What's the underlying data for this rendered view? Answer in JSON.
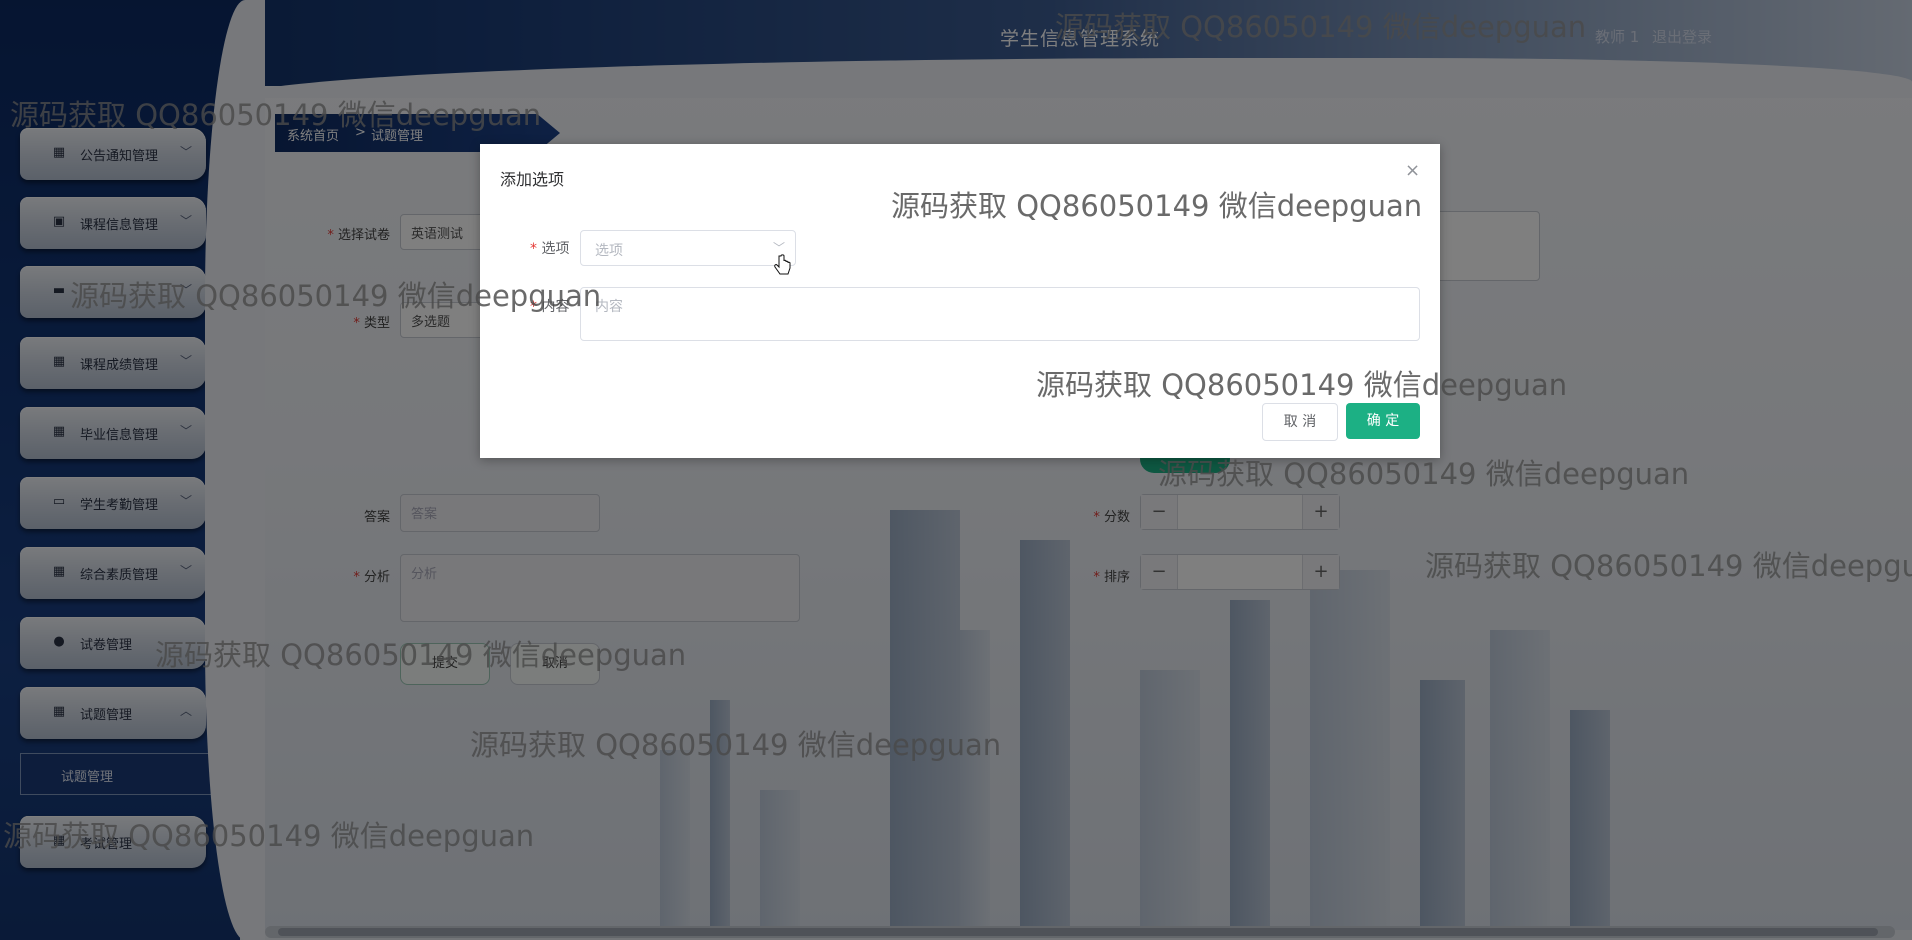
{
  "header": {
    "title": "学生信息管理系统",
    "user": "教师 1",
    "logout": "退出登录"
  },
  "sidebar": {
    "items": [
      {
        "label": "公告通知管理",
        "icon": "grid-icon"
      },
      {
        "label": "课程信息管理",
        "icon": "clipboard-icon"
      },
      {
        "label": "",
        "icon": "briefcase-icon"
      },
      {
        "label": "课程成绩管理",
        "icon": "grid-icon"
      },
      {
        "label": "毕业信息管理",
        "icon": "grid-icon"
      },
      {
        "label": "学生考勤管理",
        "icon": "monitor-icon"
      },
      {
        "label": "综合素质管理",
        "icon": "grid-icon"
      },
      {
        "label": "试卷管理",
        "icon": "user-icon"
      },
      {
        "label": "试题管理",
        "icon": "grid-icon"
      },
      {
        "label": "考试管理",
        "icon": "grid-icon"
      }
    ],
    "submenu_label": "试题管理"
  },
  "breadcrumb": {
    "home": "系统首页",
    "separator": ">",
    "current": "试题管理"
  },
  "form": {
    "paper_label": "选择试卷",
    "paper_value": "英语测试",
    "type_label": "类型",
    "type_value": "多选题",
    "answer_label": "答案",
    "answer_placeholder": "答案",
    "analysis_label": "分析",
    "analysis_placeholder": "分析",
    "score_label": "分数",
    "order_label": "排序",
    "submit_label": "提交",
    "cancel_label": "取消"
  },
  "dialog": {
    "title": "添加选项",
    "option_label": "选项",
    "option_placeholder": "选项",
    "content_label": "内容",
    "content_placeholder": "内容",
    "cancel_label": "取 消",
    "confirm_label": "确 定"
  },
  "watermark": "源码获取 QQ86050149 微信deepguan",
  "colors": {
    "accent": "#1cb084",
    "sidebar": "#123575",
    "required": "#e53935"
  }
}
